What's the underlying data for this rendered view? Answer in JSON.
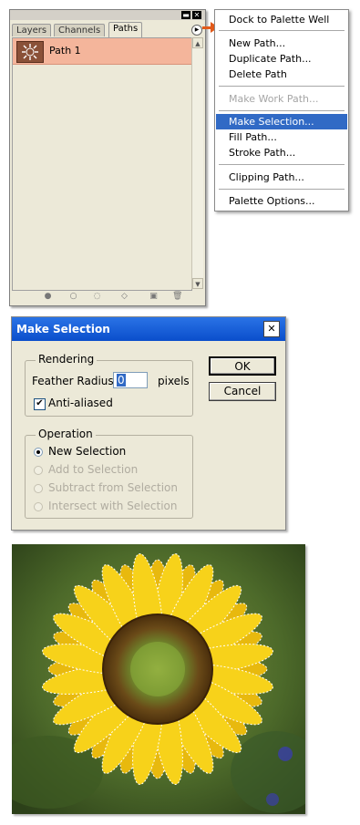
{
  "palette": {
    "tabs": [
      "Layers",
      "Channels",
      "Paths"
    ],
    "active_tab": "Paths",
    "paths": [
      {
        "name": "Path 1"
      }
    ],
    "minimize_glyph": "▬",
    "close_glyph": "✕",
    "menu_button_glyph": "▶",
    "footer_icons": [
      "fill-path-icon",
      "stroke-path-icon",
      "load-selection-icon",
      "make-work-path-icon",
      "new-path-icon",
      "delete-path-icon"
    ]
  },
  "menu": {
    "items": [
      {
        "label": "Dock to Palette Well",
        "state": "normal"
      },
      {
        "label": "New Path...",
        "state": "normal"
      },
      {
        "label": "Duplicate Path...",
        "state": "normal"
      },
      {
        "label": "Delete Path",
        "state": "normal"
      },
      {
        "label": "Make Work Path...",
        "state": "disabled"
      },
      {
        "label": "Make Selection...",
        "state": "highlighted"
      },
      {
        "label": "Fill Path...",
        "state": "normal"
      },
      {
        "label": "Stroke Path...",
        "state": "normal"
      },
      {
        "label": "Clipping Path...",
        "state": "normal"
      },
      {
        "label": "Palette Options...",
        "state": "normal"
      }
    ]
  },
  "dialog": {
    "title": "Make Selection",
    "close_glyph": "✕",
    "rendering": {
      "legend": "Rendering",
      "feather_label": "Feather Radius:",
      "feather_value": "0",
      "feather_unit": "pixels",
      "antialiased_label": "Anti-aliased",
      "antialiased_checked": true,
      "check_glyph": "✔"
    },
    "operation": {
      "legend": "Operation",
      "options": [
        {
          "label": "New Selection",
          "selected": true,
          "enabled": true
        },
        {
          "label": "Add to Selection",
          "selected": false,
          "enabled": false
        },
        {
          "label": "Subtract from Selection",
          "selected": false,
          "enabled": false
        },
        {
          "label": "Intersect with Selection",
          "selected": false,
          "enabled": false
        }
      ]
    },
    "ok_label": "OK",
    "cancel_label": "Cancel"
  },
  "colors": {
    "accent_orange": "#e25a1a",
    "selected_row": "#f4b59b",
    "menu_highlight": "#316ac5",
    "titlebar_blue": "#0a4ecb"
  }
}
